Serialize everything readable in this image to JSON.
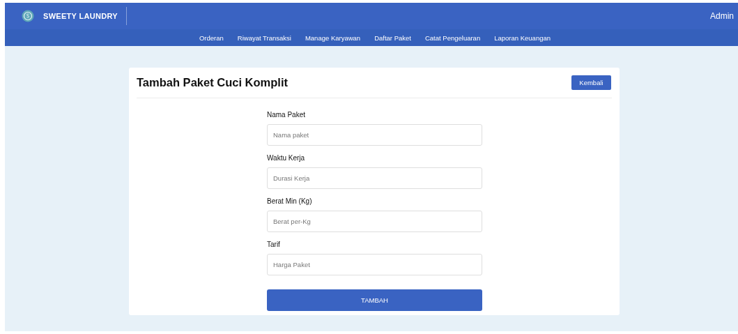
{
  "brand": {
    "name": "SWEETY LAUNDRY"
  },
  "user": "Admin",
  "nav": [
    {
      "label": "Orderan"
    },
    {
      "label": "Riwayat Transaksi"
    },
    {
      "label": "Manage Karyawan"
    },
    {
      "label": "Daftar Paket"
    },
    {
      "label": "Catat Pengeluaran"
    },
    {
      "label": "Laporan Keuangan"
    }
  ],
  "card": {
    "title": "Tambah Paket Cuci Komplit",
    "back_button": "Kembali",
    "fields": [
      {
        "label": "Nama Paket",
        "placeholder": "Nama paket"
      },
      {
        "label": "Waktu Kerja",
        "placeholder": "Durasi Kerja"
      },
      {
        "label": "Berat Min (Kg)",
        "placeholder": "Berat per-Kg"
      },
      {
        "label": "Tarif",
        "placeholder": "Harga Paket"
      }
    ],
    "submit": "TAMBAH"
  }
}
